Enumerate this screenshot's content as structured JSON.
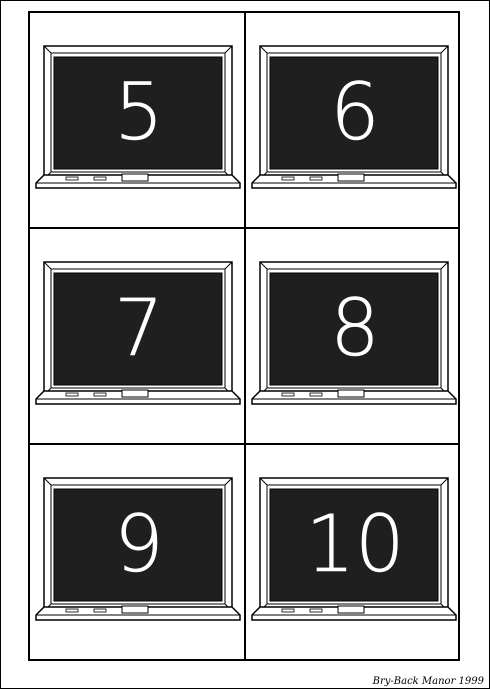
{
  "cards": [
    {
      "number": "5"
    },
    {
      "number": "6"
    },
    {
      "number": "7"
    },
    {
      "number": "8"
    },
    {
      "number": "9"
    },
    {
      "number": "10"
    }
  ],
  "credit": "Bry-Back Manor 1999",
  "colors": {
    "chalkboard": "#1f1f1f",
    "frame": "#ffffff",
    "outline": "#000000",
    "chalk": "#ffffff"
  }
}
